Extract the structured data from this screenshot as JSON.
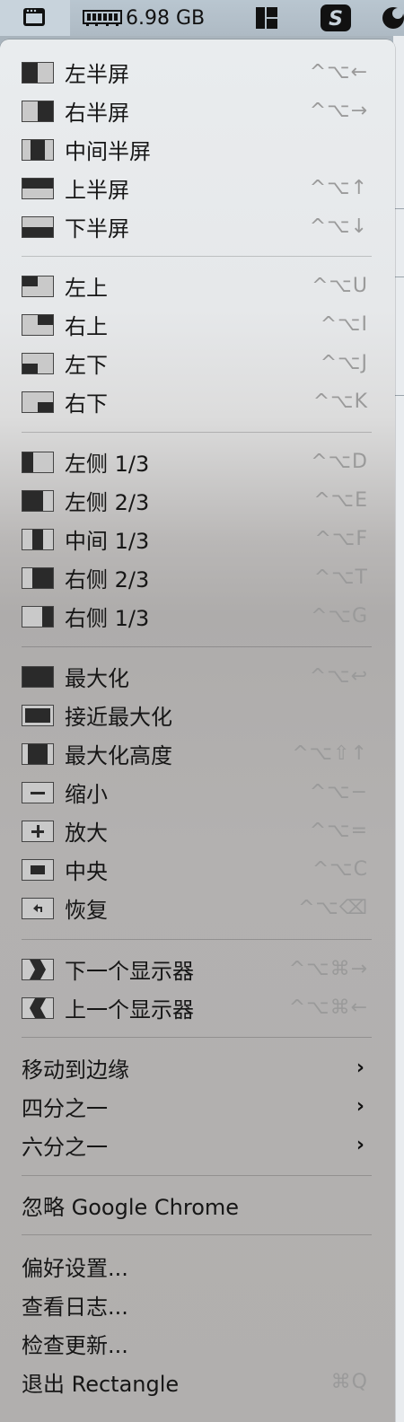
{
  "menubar": {
    "memory": "6.98 GB"
  },
  "menu": {
    "items": [
      {
        "label": "左半屏",
        "shortcut": "^⌥←"
      },
      {
        "label": "右半屏",
        "shortcut": "^⌥→"
      },
      {
        "label": "中间半屏",
        "shortcut": ""
      },
      {
        "label": "上半屏",
        "shortcut": "^⌥↑"
      },
      {
        "label": "下半屏",
        "shortcut": "^⌥↓"
      },
      {
        "label": "左上",
        "shortcut": "^⌥U"
      },
      {
        "label": "右上",
        "shortcut": "^⌥I"
      },
      {
        "label": "左下",
        "shortcut": "^⌥J"
      },
      {
        "label": "右下",
        "shortcut": "^⌥K"
      },
      {
        "label": "左侧 1/3",
        "shortcut": "^⌥D"
      },
      {
        "label": "左侧 2/3",
        "shortcut": "^⌥E"
      },
      {
        "label": "中间 1/3",
        "shortcut": "^⌥F"
      },
      {
        "label": "右侧 2/3",
        "shortcut": "^⌥T"
      },
      {
        "label": "右侧 1/3",
        "shortcut": "^⌥G"
      },
      {
        "label": "最大化",
        "shortcut": "^⌥↩"
      },
      {
        "label": "接近最大化",
        "shortcut": ""
      },
      {
        "label": "最大化高度",
        "shortcut": "^⌥⇧↑"
      },
      {
        "label": "缩小",
        "shortcut": "^⌥−"
      },
      {
        "label": "放大",
        "shortcut": "^⌥="
      },
      {
        "label": "中央",
        "shortcut": "^⌥C"
      },
      {
        "label": "恢复",
        "shortcut": "^⌥⌫"
      },
      {
        "label": "下一个显示器",
        "shortcut": "^⌥⌘→"
      },
      {
        "label": "上一个显示器",
        "shortcut": "^⌥⌘←"
      },
      {
        "label": "移动到边缘",
        "shortcut": ""
      },
      {
        "label": "四分之一",
        "shortcut": ""
      },
      {
        "label": "六分之一",
        "shortcut": ""
      },
      {
        "label": "忽略 Google Chrome",
        "shortcut": ""
      },
      {
        "label": "偏好设置...",
        "shortcut": ""
      },
      {
        "label": "查看日志...",
        "shortcut": ""
      },
      {
        "label": "检查更新...",
        "shortcut": ""
      },
      {
        "label": "退出 Rectangle",
        "shortcut": "⌘Q"
      }
    ]
  }
}
